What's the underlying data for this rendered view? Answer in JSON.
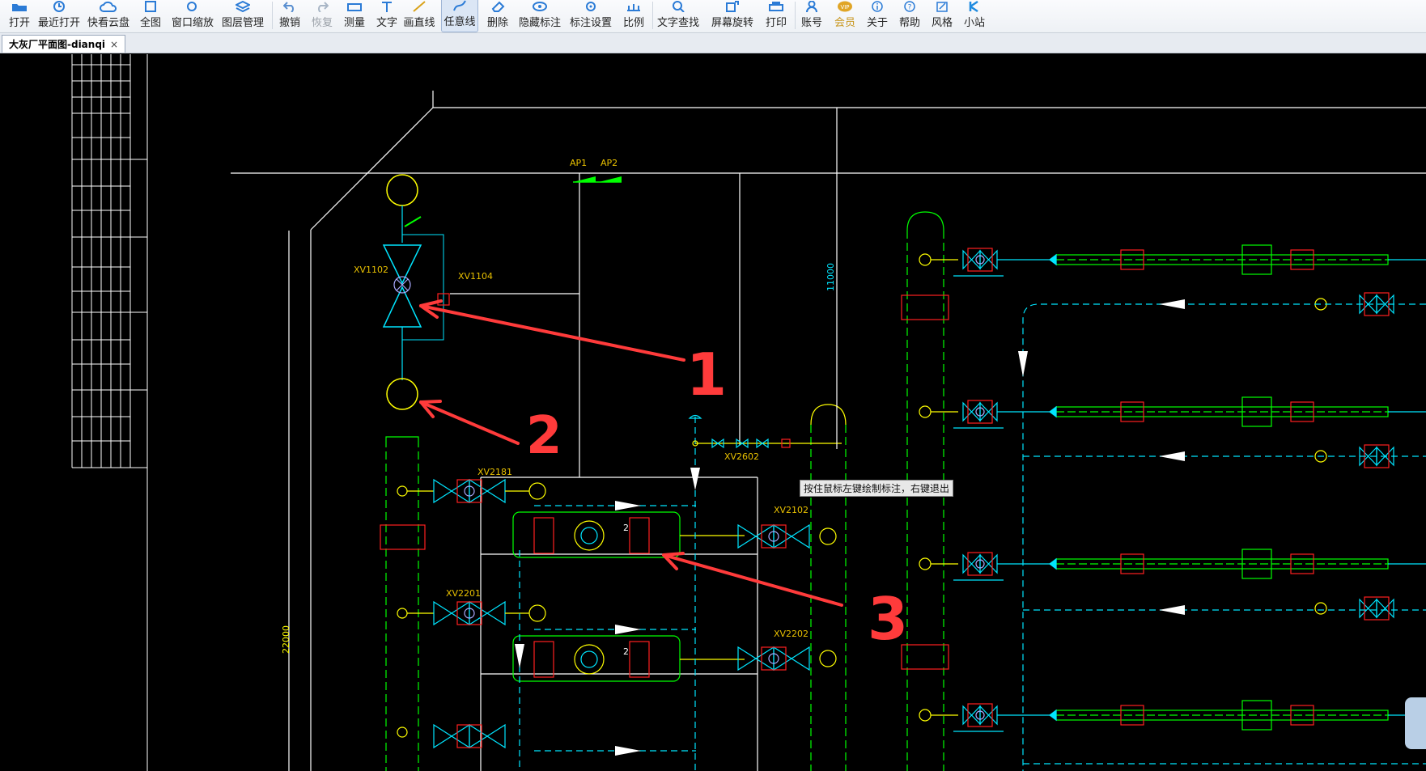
{
  "toolbar": {
    "items": [
      {
        "label": "打开",
        "icon": "folder-open-icon"
      },
      {
        "label": "最近打开",
        "icon": "recent-icon"
      },
      {
        "label": "快看云盘",
        "icon": "cloud-icon"
      },
      {
        "label": "全图",
        "icon": "fit-all-icon"
      },
      {
        "label": "窗口缩放",
        "icon": "zoom-window-icon"
      },
      {
        "label": "图层管理",
        "icon": "layers-icon"
      },
      {
        "label": "撤销",
        "icon": "undo-icon"
      },
      {
        "label": "恢复",
        "icon": "redo-icon"
      },
      {
        "label": "测量",
        "icon": "ruler-icon"
      },
      {
        "label": "文字",
        "icon": "text-icon"
      },
      {
        "label": "画直线",
        "icon": "line-icon"
      },
      {
        "label": "任意线",
        "icon": "freehand-icon"
      },
      {
        "label": "删除",
        "icon": "eraser-icon"
      },
      {
        "label": "隐藏标注",
        "icon": "eye-icon"
      },
      {
        "label": "标注设置",
        "icon": "annotation-settings-icon"
      },
      {
        "label": "比例",
        "icon": "scale-icon"
      },
      {
        "label": "文字查找",
        "icon": "text-search-icon"
      },
      {
        "label": "屏幕旋转",
        "icon": "rotate-icon"
      },
      {
        "label": "打印",
        "icon": "printer-icon"
      },
      {
        "label": "账号",
        "icon": "user-icon"
      },
      {
        "label": "会员",
        "icon": "vip-icon"
      },
      {
        "label": "关于",
        "icon": "info-icon"
      },
      {
        "label": "帮助",
        "icon": "help-icon"
      },
      {
        "label": "风格",
        "icon": "style-icon"
      },
      {
        "label": "小站",
        "icon": "k-station-icon"
      }
    ],
    "active": "任意线",
    "disabled": [
      "恢复"
    ]
  },
  "tab": {
    "title": "大灰厂平面图-dianqi",
    "close": "×"
  },
  "drawing": {
    "labels": {
      "ap1": "AP1",
      "ap2": "AP2",
      "xv1102": "XV1102",
      "xv1104": "XV1104",
      "xv2181": "XV2181",
      "xv2102": "XV2102",
      "xv2201": "XV2201",
      "xv2202": "XV2202",
      "xv2602": "XV2602",
      "dim_11000": "11000",
      "dim_22000": "22000",
      "marker_2a": "2",
      "marker_2b": "2"
    },
    "annotations": [
      "1",
      "2",
      "3"
    ]
  },
  "status": {
    "tooltip": "按住鼠标左键绘制标注，右键退出"
  },
  "colors": {
    "background": "#000000",
    "white_lines": "#ffffff",
    "yellow": "#ffff00",
    "orange_label": "#e8c000",
    "cyan": "#00e5ff",
    "green": "#00ff00",
    "red": "#ff2020",
    "annotation": "#ff3b3b",
    "vip_gold": "#c8961e"
  }
}
